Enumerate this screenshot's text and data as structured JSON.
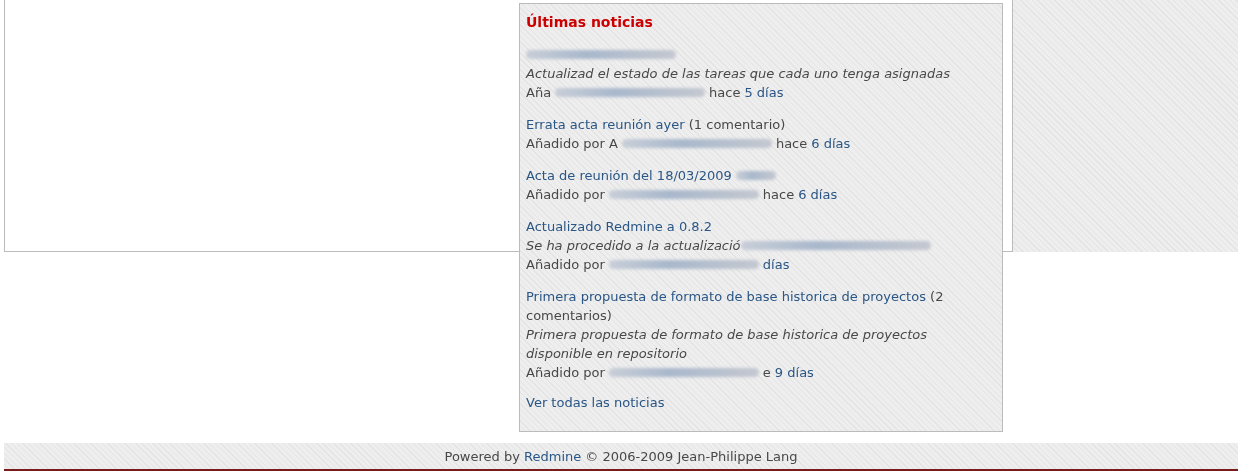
{
  "news": {
    "title": "Últimas noticias",
    "items": [
      {
        "description": "Actualizad el estado de las tareas que cada uno tenga asignadas",
        "meta_before": "Aña",
        "meta_after": "hace",
        "age": "5 días"
      },
      {
        "title": "Errata acta reunión ayer",
        "comments": "(1 comentario)",
        "meta_before": "Añadido por A",
        "meta_after": "hace",
        "age": "6 días"
      },
      {
        "title": "Acta de reunión del 18/03/2009",
        "title_blurred_tail": true,
        "meta_before": "Añadido por",
        "meta_after": "hace",
        "age": "6 días"
      },
      {
        "title": "Actualizado Redmine a 0.8.2",
        "description": "Se ha procedido a la actualizació",
        "description_blurred_tail": true,
        "meta_before": "Añadido por",
        "age": "días"
      },
      {
        "title": "Primera propuesta de formato de base historica de proyectos",
        "comments": "(2 comentarios)",
        "description": "Primera propuesta de formato de base historica de proyectos disponible en repositorio",
        "meta_before": "Añadido por",
        "meta_after": "e",
        "age": "9 días"
      }
    ],
    "all_link": "Ver todas las noticias"
  },
  "footer": {
    "before": "Powered by",
    "link": "Redmine",
    "after": "© 2006-2009 Jean-Philippe Lang"
  }
}
